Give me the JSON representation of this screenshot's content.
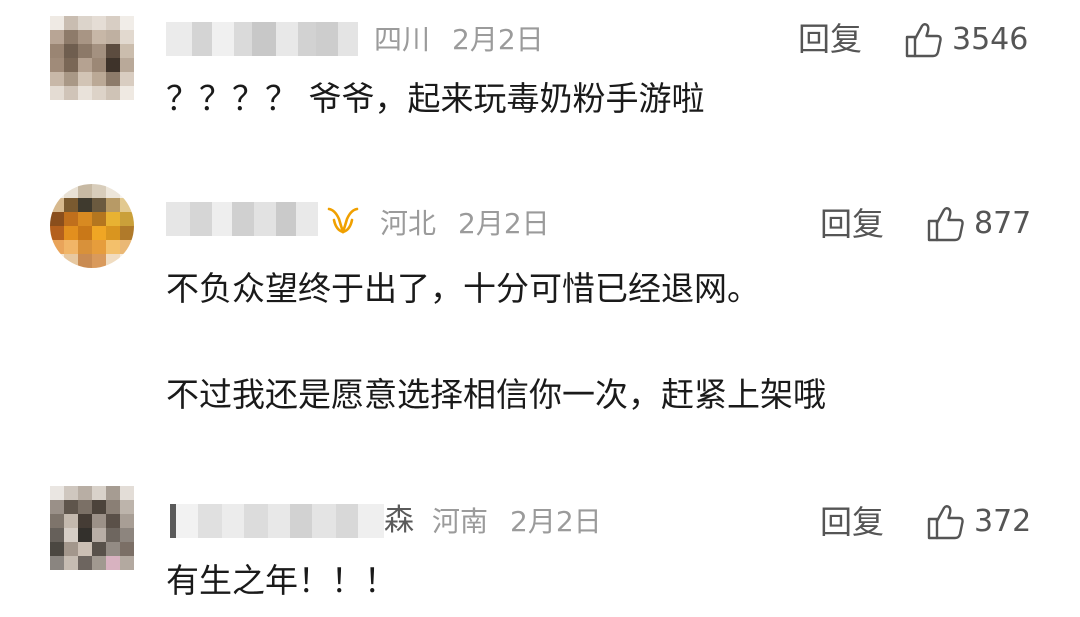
{
  "reply_label": "回复",
  "comments": [
    {
      "name_suffix": "",
      "location": "四川",
      "date": "2月2日",
      "likes": "3546",
      "lines": [
        "？？？？ 爷爷，起来玩毒奶粉手游啦"
      ]
    },
    {
      "name_suffix": "",
      "location": "河北",
      "date": "2月2日",
      "likes": "877",
      "lines": [
        "不负众望终于出了，十分可惜已经退网。",
        "不过我还是愿意选择相信你一次，赶紧上架哦"
      ]
    },
    {
      "name_suffix": "森",
      "location": "河南",
      "date": "2月2日",
      "likes": "372",
      "lines": [
        "有生之年！！！"
      ]
    }
  ],
  "icons": {
    "like": "thumbs-up-icon",
    "vip": "vip-badge-icon"
  },
  "colors": {
    "vip_badge": "#f0a000",
    "meta_text": "#9b9b9b",
    "action_text": "#555555"
  }
}
